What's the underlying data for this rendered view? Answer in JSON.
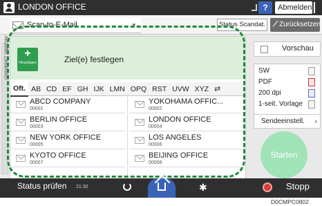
{
  "topbar": {
    "user_name": "LONDON OFFICE",
    "help_label": "?",
    "logout_label": "Abmelden"
  },
  "dest_bar": {
    "scan_mode": "Scan-to-E-Mail",
    "status_label": "Status Scandat.",
    "reset_label": "Zurücksetzen"
  },
  "left_tab": {
    "text": "Aktueller Zielbereich"
  },
  "panel": {
    "add_label": "Hinzufügen",
    "title": "Ziel(e) festlegen",
    "index_tabs": [
      "Oft.",
      "AB",
      "CD",
      "EF",
      "GH",
      "IJK",
      "LMN",
      "OPQ",
      "RST",
      "UVW",
      "XYZ"
    ],
    "selected_tab": "Oft.",
    "entries": [
      {
        "name": "ABCD COMPANY",
        "number": "00001"
      },
      {
        "name": "YOKOHAMA OFFIC...",
        "number": "00002"
      },
      {
        "name": "BERLIN OFFICE",
        "number": "00003"
      },
      {
        "name": "LONDON OFFICE",
        "number": "00004"
      },
      {
        "name": "NEW YORK OFFICE",
        "number": "00005"
      },
      {
        "name": "LOS ANGELES",
        "number": "00006"
      },
      {
        "name": "KYOTO OFFICE",
        "number": "00007"
      },
      {
        "name": "BEIJING OFFICE",
        "number": "00008"
      }
    ]
  },
  "right_panel": {
    "preview_label": "Vorschau",
    "color": "SW",
    "file_type": "PDF",
    "resolution": "200 dpi",
    "original": "1-seit. Vorlage",
    "send_settings_label": "Sendeeinstell.",
    "start_label": "Starten"
  },
  "bottombar": {
    "status_check_label": "Status prüfen",
    "clock": "21:30",
    "stop_label": "Stopp"
  },
  "figure_code": "D0CMPC0802",
  "colors": {
    "accent_green": "#2f9e4f",
    "highlight_green": "#1e8a3c",
    "start_green": "#9fe3b6",
    "home_blue": "#3a63b8",
    "stop_red": "#d3423b"
  },
  "icons": [
    "user-icon",
    "mail-icon",
    "reset-icon",
    "sort-icon",
    "back-icon",
    "home-icon",
    "gear-icon",
    "stop-icon",
    "power-icon"
  ]
}
